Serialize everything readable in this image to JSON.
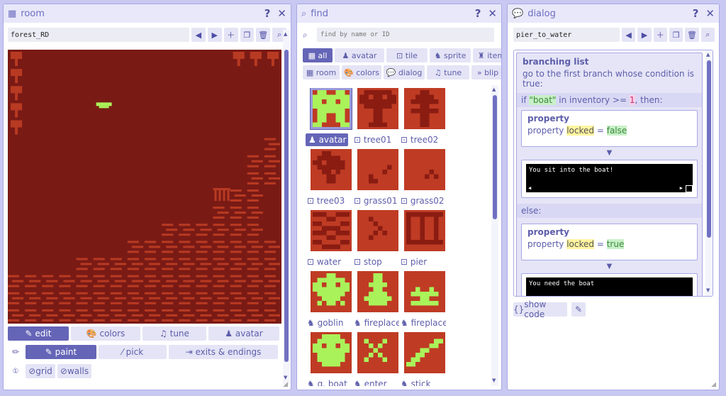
{
  "room": {
    "title": "room",
    "name_value": "forest_RD",
    "tabs": [
      "edit",
      "colors",
      "tune",
      "avatar"
    ],
    "tools": [
      "paint",
      "pick",
      "exits & endings"
    ],
    "toggles": [
      "grid",
      "walls"
    ]
  },
  "find": {
    "title": "find",
    "placeholder": "find by name or ID",
    "filters": [
      "all",
      "avatar",
      "tile",
      "sprite",
      "item",
      "room",
      "colors",
      "dialog",
      "tune",
      "blip"
    ],
    "items": [
      "avatar",
      "tree01",
      "tree02",
      "tree03",
      "grass01",
      "grass02",
      "water",
      "stop",
      "pier",
      "goblin",
      "fireplace",
      "fireplace",
      "g. boat",
      "enter",
      "stick"
    ]
  },
  "dialog": {
    "title": "dialog",
    "name_value": "pier_to_water",
    "branch_title": "branching list",
    "branch_desc": "go to the first branch whose condition is true:",
    "cond": {
      "if": "if",
      "item": "\"boat\"",
      "mid": "in inventory >=",
      "num": "1",
      "end": ", then:"
    },
    "prop1": {
      "title": "property",
      "pre": "property",
      "key": "locked",
      "eq": "=",
      "val": "false"
    },
    "text1": "You sit into the boat!",
    "else_label": "else:",
    "prop2": {
      "title": "property",
      "pre": "property",
      "key": "locked",
      "eq": "=",
      "val": "true"
    },
    "text2": "You need the boat",
    "show_code": "show code"
  },
  "colors": {
    "accent": "#6565b8",
    "room_bg": "#7a1a15",
    "room_fg": "#b83a22",
    "tile_bg": "#bf3b24",
    "sprite_fg": "#aaf25a"
  }
}
